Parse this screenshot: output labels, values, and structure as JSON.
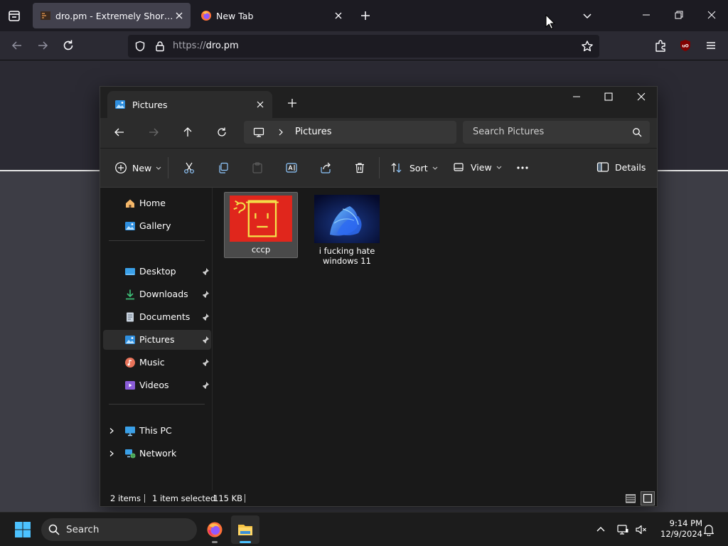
{
  "browser": {
    "tabs": [
      {
        "title": "dro.pm - Extremely Short Links",
        "active": true
      },
      {
        "title": "New Tab",
        "active": false
      }
    ],
    "url": {
      "scheme": "https://",
      "host": "dro.pm"
    }
  },
  "explorer": {
    "tab_title": "Pictures",
    "breadcrumb": "Pictures",
    "search_placeholder": "Search Pictures",
    "toolbar": {
      "new_label": "New",
      "sort_label": "Sort",
      "view_label": "View",
      "details_label": "Details"
    },
    "nav": {
      "quick": [
        "Home",
        "Gallery"
      ],
      "pinned": [
        "Desktop",
        "Downloads",
        "Documents",
        "Pictures",
        "Music",
        "Videos"
      ],
      "locations": [
        "This PC",
        "Network"
      ],
      "selected": "Pictures"
    },
    "files": [
      {
        "name": "cccp",
        "selected": true
      },
      {
        "name": "i fucking hate windows 11",
        "selected": false
      }
    ],
    "status": {
      "items": "2 items",
      "selection": "1 item selected",
      "size": "115 KB"
    }
  },
  "taskbar": {
    "search_label": "Search",
    "time": "9:14 PM",
    "date": "12/9/2024"
  },
  "colors": {
    "accent": "#4cc2ff",
    "firefox_bg": "#2b2a33",
    "explorer_bg": "#191919",
    "ublock_red": "#800000"
  }
}
